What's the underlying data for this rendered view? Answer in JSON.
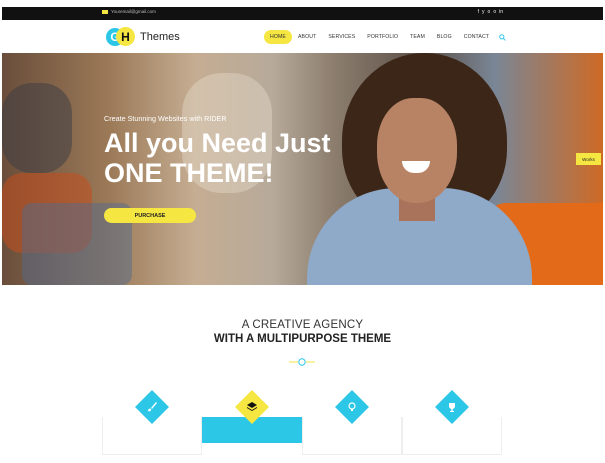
{
  "topbar": {
    "email": "Youremail@gmail.com",
    "social_icons": [
      "facebook-icon",
      "twitter-icon",
      "instagram-icon",
      "pinterest-icon",
      "linkedin-icon"
    ],
    "social_glyphs": [
      "f",
      "y",
      "o",
      "o",
      "in"
    ]
  },
  "logo": {
    "g_letter": "G",
    "h_letter": "H",
    "text": "Themes"
  },
  "nav": {
    "items": [
      "HOME",
      "ABOUT",
      "SERVICES",
      "PORTFOLIO",
      "TEAM",
      "BLOG",
      "CONTACT"
    ],
    "active_index": 0
  },
  "hero": {
    "tagline": "Create Stunning Websites with RIDER",
    "headline_line1": "All you Need Just",
    "headline_line2": "ONE THEME!",
    "button_label": "PURCHASE",
    "side_tab": "Works"
  },
  "section": {
    "line1": "A CREATIVE AGENCY",
    "line2": "WITH A MULTIPURPOSE THEME"
  },
  "features": {
    "icons": [
      "brush-icon",
      "layers-icon",
      "lightbulb-icon",
      "trophy-icon"
    ],
    "active_index": 1
  },
  "colors": {
    "accent_yellow": "#f5e642",
    "accent_cyan": "#2cc7e7",
    "topbar_bg": "#111111"
  }
}
